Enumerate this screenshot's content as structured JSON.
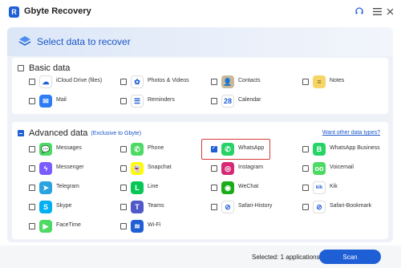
{
  "window": {
    "title": "Gbyte Recovery",
    "logo_letter": "R"
  },
  "banner": {
    "title": "Select data to recover"
  },
  "basic": {
    "title": "Basic data",
    "items": [
      {
        "label": "iCloud Drive (files)",
        "icon": "cloud-icon",
        "color": "#ffffff",
        "glyph": "☁"
      },
      {
        "label": "Photos & Videos",
        "icon": "photos-icon",
        "color": "#ffffff",
        "glyph": "✿"
      },
      {
        "label": "Contacts",
        "icon": "contacts-icon",
        "color": "#c9b99a",
        "glyph": "👤"
      },
      {
        "label": "Notes",
        "icon": "notes-icon",
        "color": "#f6d465",
        "glyph": "≡"
      },
      {
        "label": "Mail",
        "icon": "mail-icon",
        "color": "#2e7cf6",
        "glyph": "✉"
      },
      {
        "label": "Reminders",
        "icon": "reminders-icon",
        "color": "#ffffff",
        "glyph": "☰"
      },
      {
        "label": "Calendar",
        "icon": "calendar-icon",
        "color": "#ffffff",
        "glyph": "28",
        "badge": "TUE"
      }
    ]
  },
  "advanced": {
    "title": "Advanced data",
    "subtitle": "(Exclusive to Gbyte)",
    "more_link": "Want other data types?",
    "items": [
      {
        "label": "Messages",
        "icon": "messages-icon",
        "color": "#4cd964",
        "glyph": "💬",
        "checked": false
      },
      {
        "label": "Phone",
        "icon": "phone-icon",
        "color": "#4cd964",
        "glyph": "✆",
        "checked": false
      },
      {
        "label": "WhatsApp",
        "icon": "whatsapp-icon",
        "color": "#25d366",
        "glyph": "✆",
        "checked": true
      },
      {
        "label": "WhatsApp Business",
        "icon": "whatsapp-business-icon",
        "color": "#25d366",
        "glyph": "B",
        "checked": false
      },
      {
        "label": "Messenger",
        "icon": "messenger-icon",
        "color": "#7b5cff",
        "glyph": "ϟ",
        "checked": false
      },
      {
        "label": "Snapchat",
        "icon": "snapchat-icon",
        "color": "#fffc00",
        "glyph": "👻",
        "checked": false
      },
      {
        "label": "Instagram",
        "icon": "instagram-icon",
        "color": "#d62976",
        "glyph": "◎",
        "checked": false
      },
      {
        "label": "Voicemail",
        "icon": "voicemail-icon",
        "color": "#4cd964",
        "glyph": "oo",
        "checked": false
      },
      {
        "label": "Telegram",
        "icon": "telegram-icon",
        "color": "#2aa3de",
        "glyph": "➤",
        "checked": false
      },
      {
        "label": "Line",
        "icon": "line-icon",
        "color": "#06c755",
        "glyph": "L",
        "checked": false
      },
      {
        "label": "WeChat",
        "icon": "wechat-icon",
        "color": "#1aad19",
        "glyph": "◉",
        "checked": false
      },
      {
        "label": "Kik",
        "icon": "kik-icon",
        "color": "#ffffff",
        "glyph": "kik",
        "checked": false
      },
      {
        "label": "Skype",
        "icon": "skype-icon",
        "color": "#00aff0",
        "glyph": "S",
        "checked": false
      },
      {
        "label": "Teams",
        "icon": "teams-icon",
        "color": "#5059c9",
        "glyph": "T",
        "checked": false
      },
      {
        "label": "Safari-History",
        "icon": "safari-icon",
        "color": "#ffffff",
        "glyph": "⊘",
        "checked": false
      },
      {
        "label": "Safari-Bookmark",
        "icon": "safari-bookmark-icon",
        "color": "#ffffff",
        "glyph": "⊘",
        "checked": false
      },
      {
        "label": "FaceTime",
        "icon": "facetime-icon",
        "color": "#4cd964",
        "glyph": "▶",
        "checked": false
      },
      {
        "label": "Wi-Fi",
        "icon": "wifi-icon",
        "color": "#1f5fd6",
        "glyph": "≋",
        "checked": false
      }
    ]
  },
  "footer": {
    "selected_text": "Selected: 1 applications",
    "scan_label": "Scan"
  },
  "colors": {
    "accent": "#1f5fd6",
    "highlight": "#d63a3a"
  }
}
